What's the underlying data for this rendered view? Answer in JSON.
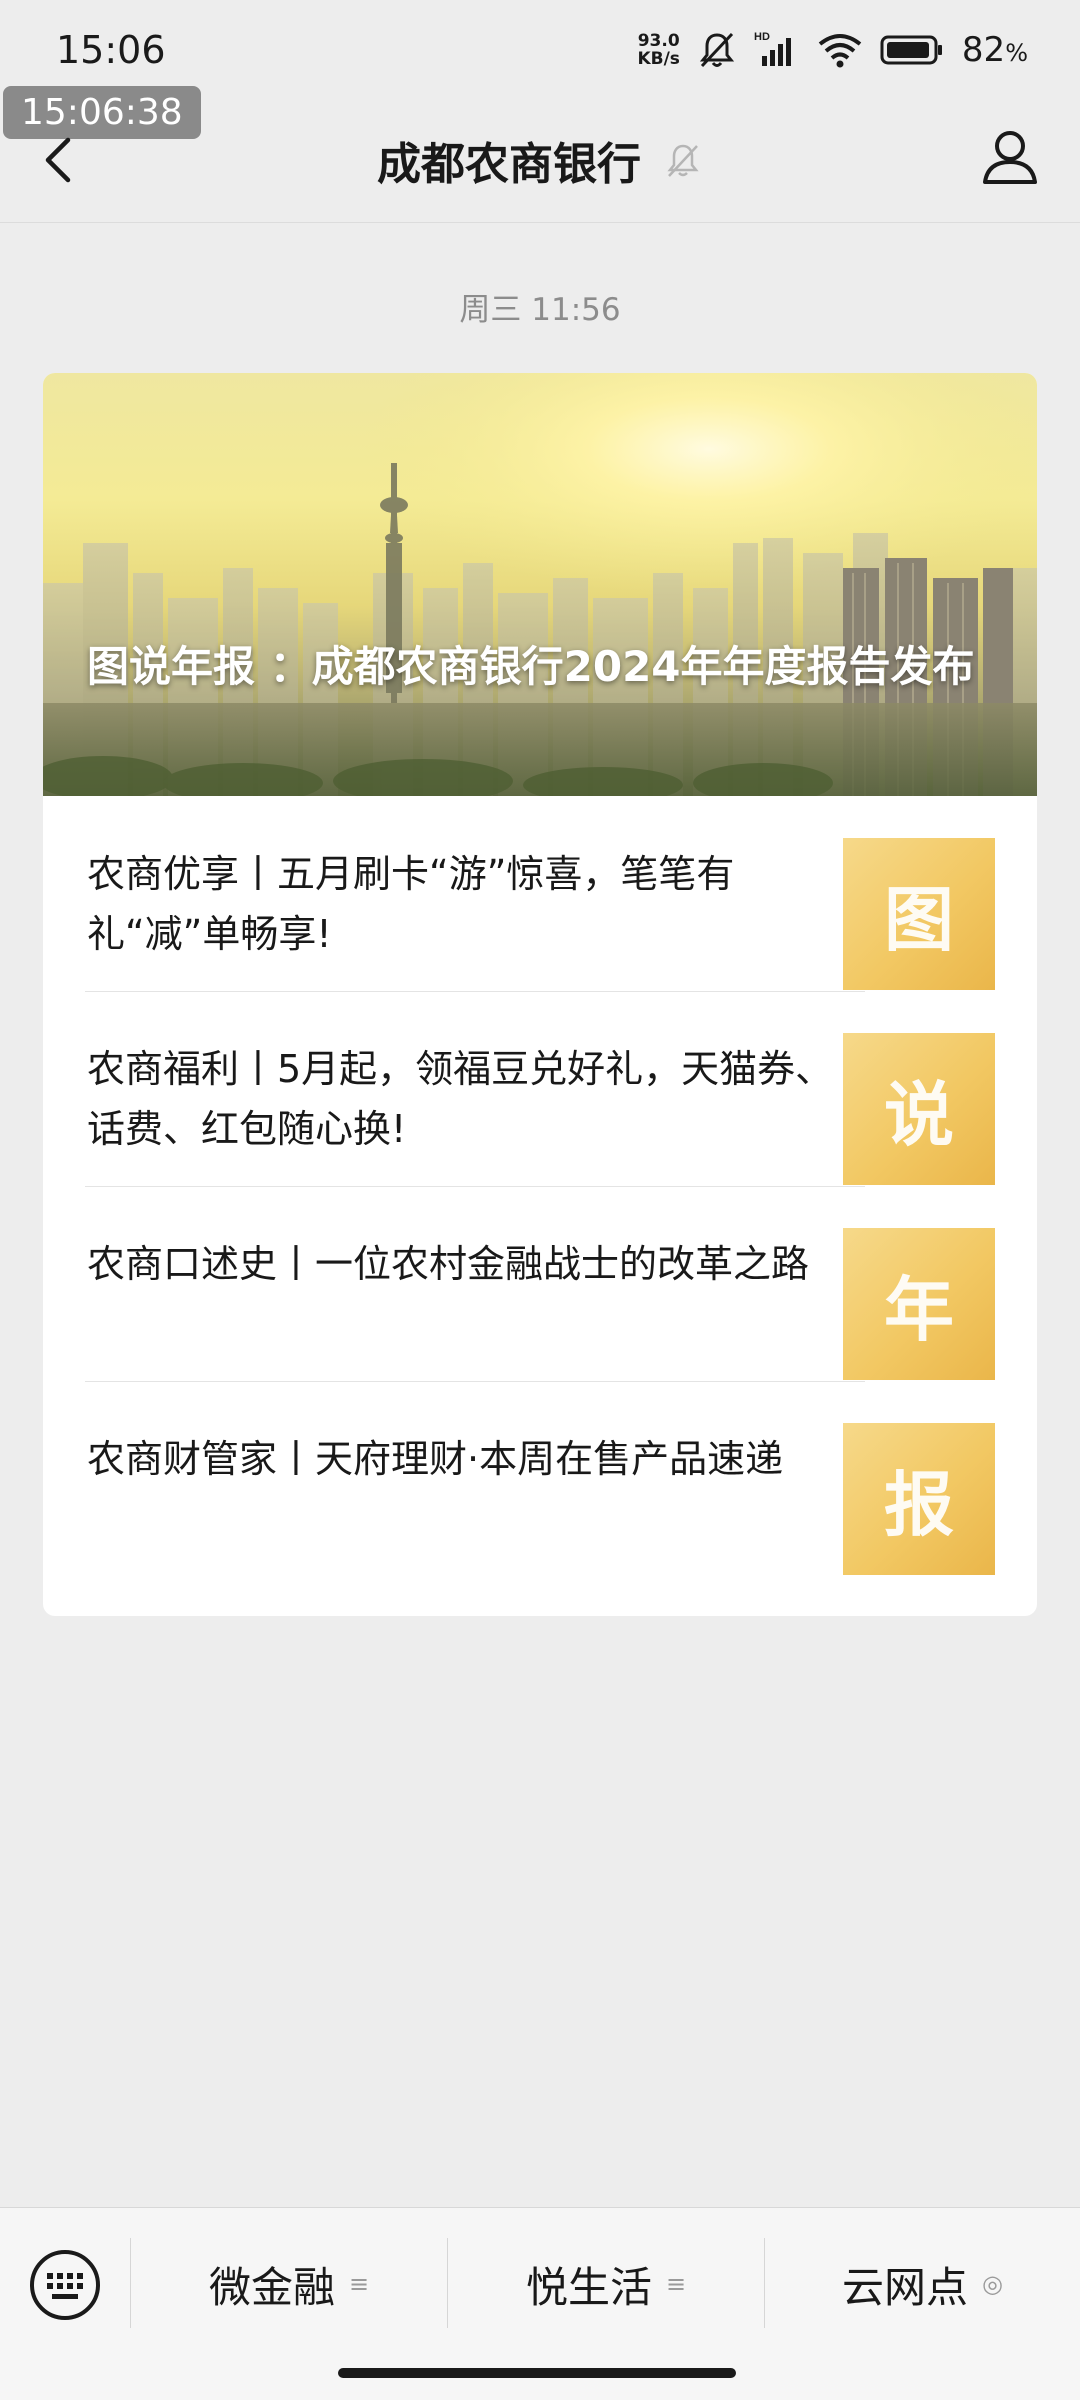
{
  "status_bar": {
    "time": "15:06",
    "net_speed_value": "93.0",
    "net_speed_unit": "KB/s",
    "network_badge": "HD",
    "battery_percent": "82",
    "battery_unit": "%"
  },
  "overlay_clock": "15:06:38",
  "nav": {
    "title": "成都农商银行"
  },
  "message_time": "周三 11:56",
  "article": {
    "hero_title": "图说年报 ：成都农商银行2024年年度报告发布",
    "items": [
      {
        "title": "农商优享丨五月刷卡“游”惊喜，笔笔有礼“减”单畅享!",
        "thumb_text": "图"
      },
      {
        "title": "农商福利丨5月起，领福豆兑好礼，天猫券、话费、红包随心换!",
        "thumb_text": "说"
      },
      {
        "title": "农商口述史丨一位农村金融战士的改革之路",
        "thumb_text": "年"
      },
      {
        "title": "农商财管家丨天府理财·本周在售产品速递",
        "thumb_text": "报"
      }
    ]
  },
  "bottom_menu": {
    "items": [
      {
        "label": "微金融",
        "mark": "≡"
      },
      {
        "label": "悦生活",
        "mark": "≡"
      },
      {
        "label": "云网点",
        "mark": "◎"
      }
    ]
  }
}
